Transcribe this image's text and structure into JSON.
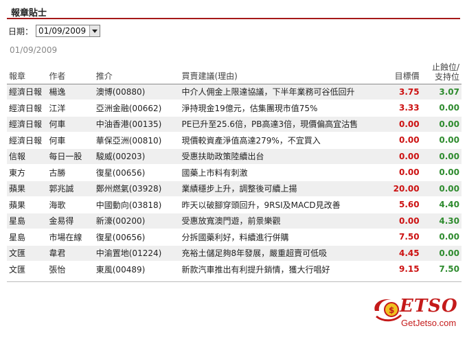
{
  "page": {
    "title": "報章貼士"
  },
  "filter": {
    "label": "日期：",
    "selected": "01/09/2009"
  },
  "current_date": "01/09/2009",
  "table": {
    "headers": {
      "paper": "報章",
      "author": "作者",
      "stock": "推介",
      "reason": "買賣建議(理由)",
      "target": "目標價",
      "stop_line1": "止蝕位/",
      "stop_line2": "支持位"
    },
    "rows": [
      {
        "paper": "經濟日報",
        "author": "楊逸",
        "stock": "澳博(00880)",
        "reason": "中介人佣金上限達協議，下半年業務可谷低回升",
        "target": "3.75",
        "stop": "3.07"
      },
      {
        "paper": "經濟日報",
        "author": "江洋",
        "stock": "亞洲金融(00662)",
        "reason": "淨持現金19億元，估集團現市值75%",
        "target": "3.33",
        "stop": "0.00"
      },
      {
        "paper": "經濟日報",
        "author": "何車",
        "stock": "中油香港(00135)",
        "reason": "PE已升至25.6倍，PB高達3倍，現價偏高宜沽售",
        "target": "0.00",
        "stop": "0.00"
      },
      {
        "paper": "經濟日報",
        "author": "何車",
        "stock": "華保亞洲(00810)",
        "reason": "現價較資產淨值高達279%，不宜買入",
        "target": "0.00",
        "stop": "0.00"
      },
      {
        "paper": "信報",
        "author": "每日一股",
        "stock": "駿威(00203)",
        "reason": "受惠扶助政策陸續出台",
        "target": "0.00",
        "stop": "0.00"
      },
      {
        "paper": "東方",
        "author": "古勝",
        "stock": "復星(00656)",
        "reason": "國藥上市料有刺激",
        "target": "0.00",
        "stop": "0.00"
      },
      {
        "paper": "蘋果",
        "author": "郭兆誠",
        "stock": "鄭州燃氣(03928)",
        "reason": "業績穩步上升，調整後可續上揚",
        "target": "20.00",
        "stop": "0.00"
      },
      {
        "paper": "蘋果",
        "author": "海歌",
        "stock": "中國動向(03818)",
        "reason": "昨天以破腳穿頭回升，9RSI及MACD見改善",
        "target": "5.60",
        "stop": "4.40"
      },
      {
        "paper": "星島",
        "author": "金易得",
        "stock": "新濠(00200)",
        "reason": "受惠放寬澳門遊，前景樂觀",
        "target": "0.00",
        "stop": "4.30"
      },
      {
        "paper": "星島",
        "author": "市場在線",
        "stock": "復星(00656)",
        "reason": "分拆國藥利好，料續進行併購",
        "target": "7.50",
        "stop": "0.00"
      },
      {
        "paper": "文匯",
        "author": "韋君",
        "stock": "中渝置地(01224)",
        "reason": "充裕土儲足夠8年發展，嚴重超賣可低吸",
        "target": "4.45",
        "stop": "0.00"
      },
      {
        "paper": "文匯",
        "author": "張怡",
        "stock": "東風(00489)",
        "reason": "新款汽車推出有利提升銷情，獲大行唱好",
        "target": "9.15",
        "stop": "7.50"
      }
    ]
  },
  "watermark": {
    "brand": "ETSO",
    "domain": "GetJetso.com"
  },
  "colors": {
    "accent": "#a51818",
    "target": "#cc1111",
    "stop": "#2e8b2e",
    "row_alt": "#efefef"
  }
}
